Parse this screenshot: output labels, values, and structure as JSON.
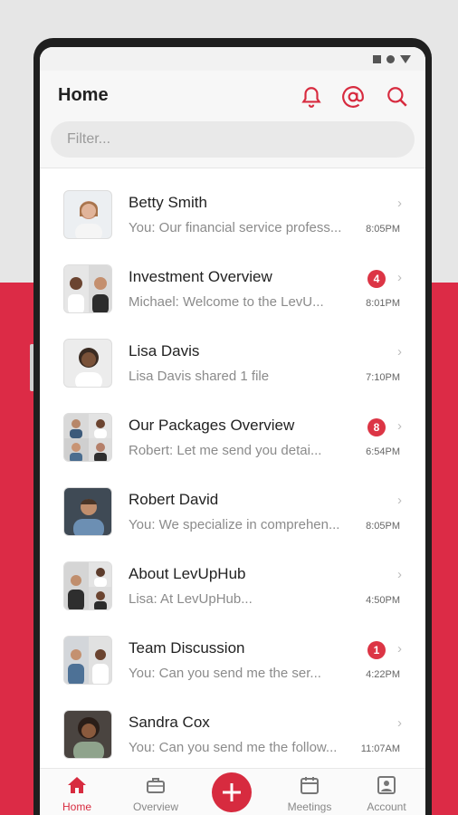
{
  "header": {
    "title": "Home",
    "search_placeholder": "Filter...",
    "icons": [
      "bell-icon",
      "at-icon",
      "search-icon"
    ]
  },
  "conversations": [
    {
      "name": "Betty Smith",
      "preview": "You: Our financial service profess...",
      "time": "8:05PM",
      "badge": null
    },
    {
      "name": "Investment Overview",
      "preview": "Michael:  Welcome to the LevU...",
      "time": "8:01PM",
      "badge": "4"
    },
    {
      "name": "Lisa Davis",
      "preview": "Lisa Davis shared 1 file",
      "time": "7:10PM",
      "badge": null
    },
    {
      "name": "Our Packages Overview",
      "preview": "Robert:  Let me send you detai...",
      "time": "6:54PM",
      "badge": "8"
    },
    {
      "name": "Robert David",
      "preview": "You: We specialize in comprehen...",
      "time": "8:05PM",
      "badge": null
    },
    {
      "name": "About LevUpHub",
      "preview": "Lisa:  At LevUpHub...",
      "time": "4:50PM",
      "badge": null
    },
    {
      "name": "Team Discussion",
      "preview": "You:  Can you send me the ser...",
      "time": "4:22PM",
      "badge": "1"
    },
    {
      "name": "Sandra Cox",
      "preview": "You:  Can you send me the follow...",
      "time": "11:07AM",
      "badge": null
    }
  ],
  "tabbar": {
    "home": "Home",
    "overview": "Overview",
    "meetings": "Meetings",
    "account": "Account"
  },
  "colors": {
    "accent": "#d72b3f",
    "badge": "#dc3545",
    "background_band": "#dc2b46"
  }
}
